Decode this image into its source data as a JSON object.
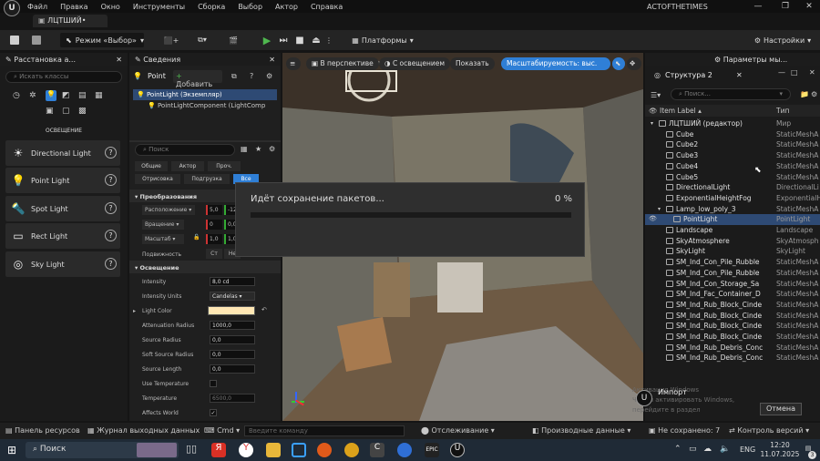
{
  "app": {
    "menu": [
      "Файл",
      "Правка",
      "Окно",
      "Инструменты",
      "Сборка",
      "Выбор",
      "Актор",
      "Справка"
    ],
    "project_name": "ACTOFTHETIMES",
    "level_tab": "ЛЦТШИЙ•"
  },
  "toolbar": {
    "mode_label": "Режим «Выбор»",
    "platforms_label": "Платформы",
    "settings_label": "Настройки"
  },
  "place_actors": {
    "title": "Расстановка а...",
    "search_placeholder": "Искать классы",
    "category": "ОСВЕЩЕНИЕ",
    "items": [
      {
        "label": "Directional Light",
        "icon": "directional-light-icon"
      },
      {
        "label": "Point Light",
        "icon": "point-light-icon"
      },
      {
        "label": "Spot Light",
        "icon": "spot-light-icon"
      },
      {
        "label": "Rect Light",
        "icon": "rect-light-icon"
      },
      {
        "label": "Sky Light",
        "icon": "sky-light-icon"
      }
    ]
  },
  "details": {
    "title": "Сведения",
    "actor_short": "Point",
    "add_label": "Добавить",
    "selected_item": "PointLight (Экземпляр)",
    "component_item": "PointLightComponent (LightComp",
    "search_placeholder": "Поиск",
    "filter_tabs": [
      "Общие",
      "Актор",
      "Проч.",
      "Отрисовка",
      "Подгрузка",
      "Все"
    ],
    "transform_header": "Преобразования",
    "transform_rows": [
      {
        "label": "Расположение",
        "v1": "5,0",
        "v2": "-12"
      },
      {
        "label": "Вращение",
        "v1": "0",
        "v2": "0,0"
      },
      {
        "label": "Масштаб",
        "v1": "1,0",
        "v2": "1,0"
      }
    ],
    "mobility_label": "Подвижность",
    "mobility_opts": [
      "Ст",
      "Не"
    ],
    "lighting_header": "Освещение",
    "props": [
      {
        "label": "Intensity",
        "value": "8,0 cd"
      },
      {
        "label": "Intensity Units",
        "value": "Candelas"
      },
      {
        "label": "Light Color",
        "value": ""
      },
      {
        "label": "Attenuation Radius",
        "value": "1000,0"
      },
      {
        "label": "Source Radius",
        "value": "0,0"
      },
      {
        "label": "Soft Source Radius",
        "value": "0,0"
      },
      {
        "label": "Source Length",
        "value": "0,0"
      },
      {
        "label": "Use Temperature",
        "value": ""
      },
      {
        "label": "Temperature",
        "value": "6500,0"
      },
      {
        "label": "Affects World",
        "value": ""
      }
    ]
  },
  "viewport": {
    "perspective": "В перспективе",
    "lit": "С освещением",
    "show": "Показать",
    "scalability": "Масштабируемость: выс."
  },
  "save_dialog": {
    "text": "Идёт сохранение пакетов...",
    "percent": "0 %",
    "progress": 0.0
  },
  "outliner": {
    "title": "Структура 2",
    "world_settings_tab": "Параметры мы...",
    "search_placeholder": "Поиск...",
    "col_label": "Item Label",
    "col_type": "Тип",
    "rows": [
      {
        "name": "ЛЦТШИЙ (редактор)",
        "type": "Мир",
        "indent": 1
      },
      {
        "name": "Cube",
        "type": "StaticMeshA",
        "indent": 2
      },
      {
        "name": "Cube2",
        "type": "StaticMeshA",
        "indent": 2
      },
      {
        "name": "Cube3",
        "type": "StaticMeshA",
        "indent": 2
      },
      {
        "name": "Cube4",
        "type": "StaticMeshA",
        "indent": 2
      },
      {
        "name": "Cube5",
        "type": "StaticMeshA",
        "indent": 2
      },
      {
        "name": "DirectionalLight",
        "type": "DirectionalLi",
        "indent": 2
      },
      {
        "name": "ExponentialHeightFog",
        "type": "ExponentialH",
        "indent": 2
      },
      {
        "name": "Lamp_low_poly_3",
        "type": "StaticMeshA",
        "indent": 2
      },
      {
        "name": "PointLight",
        "type": "PointLight",
        "indent": 3
      },
      {
        "name": "Landscape",
        "type": "Landscape",
        "indent": 2
      },
      {
        "name": "SkyAtmosphere",
        "type": "SkyAtmosph",
        "indent": 2
      },
      {
        "name": "SkyLight",
        "type": "SkyLight",
        "indent": 2
      },
      {
        "name": "SM_Ind_Con_Pile_Rubble",
        "type": "StaticMeshA",
        "indent": 2
      },
      {
        "name": "SM_Ind_Con_Pile_Rubble",
        "type": "StaticMeshA",
        "indent": 2
      },
      {
        "name": "SM_Ind_Con_Storage_Sa",
        "type": "StaticMeshA",
        "indent": 2
      },
      {
        "name": "SM_Ind_Fac_Container_D",
        "type": "StaticMeshA",
        "indent": 2
      },
      {
        "name": "SM_Ind_Rub_Block_Cinde",
        "type": "StaticMeshA",
        "indent": 2
      },
      {
        "name": "SM_Ind_Rub_Block_Cinde",
        "type": "StaticMeshA",
        "indent": 2
      },
      {
        "name": "SM_Ind_Rub_Block_Cinde",
        "type": "StaticMeshA",
        "indent": 2
      },
      {
        "name": "SM_Ind_Rub_Block_Cinde",
        "type": "StaticMeshA",
        "indent": 2
      },
      {
        "name": "SM_Ind_Rub_Debris_Conc",
        "type": "StaticMeshA",
        "indent": 2
      },
      {
        "name": "SM_Ind_Rub_Debris_Conc",
        "type": "StaticMeshA",
        "indent": 2
      }
    ]
  },
  "notifications": {
    "import_label": "Импорт",
    "windows_watermark": "Активация Windows\nЧтобы активировать Windows, перейдите в раздел",
    "cancel_label": "Отмена"
  },
  "bottom_bar": {
    "content_browser": "Панель ресурсов",
    "output_log": "Журнал выходных данных",
    "cmd": "Cmd",
    "cmd_placeholder": "Введите команду",
    "trace": "Отслеживание",
    "derived_data": "Производные данные",
    "unsaved": "Не сохранено: 7",
    "source_control": "Контроль версий"
  },
  "taskbar": {
    "search_label": "Поиск",
    "lang": "ENG",
    "time": "12:20",
    "date": "11.07.2025",
    "notif_count": "3"
  },
  "colors": {
    "accent": "#2f7fd6",
    "selected_row": "#2e4a74",
    "play_green": "#4fb84f",
    "light_color": "#ffe7b4"
  }
}
